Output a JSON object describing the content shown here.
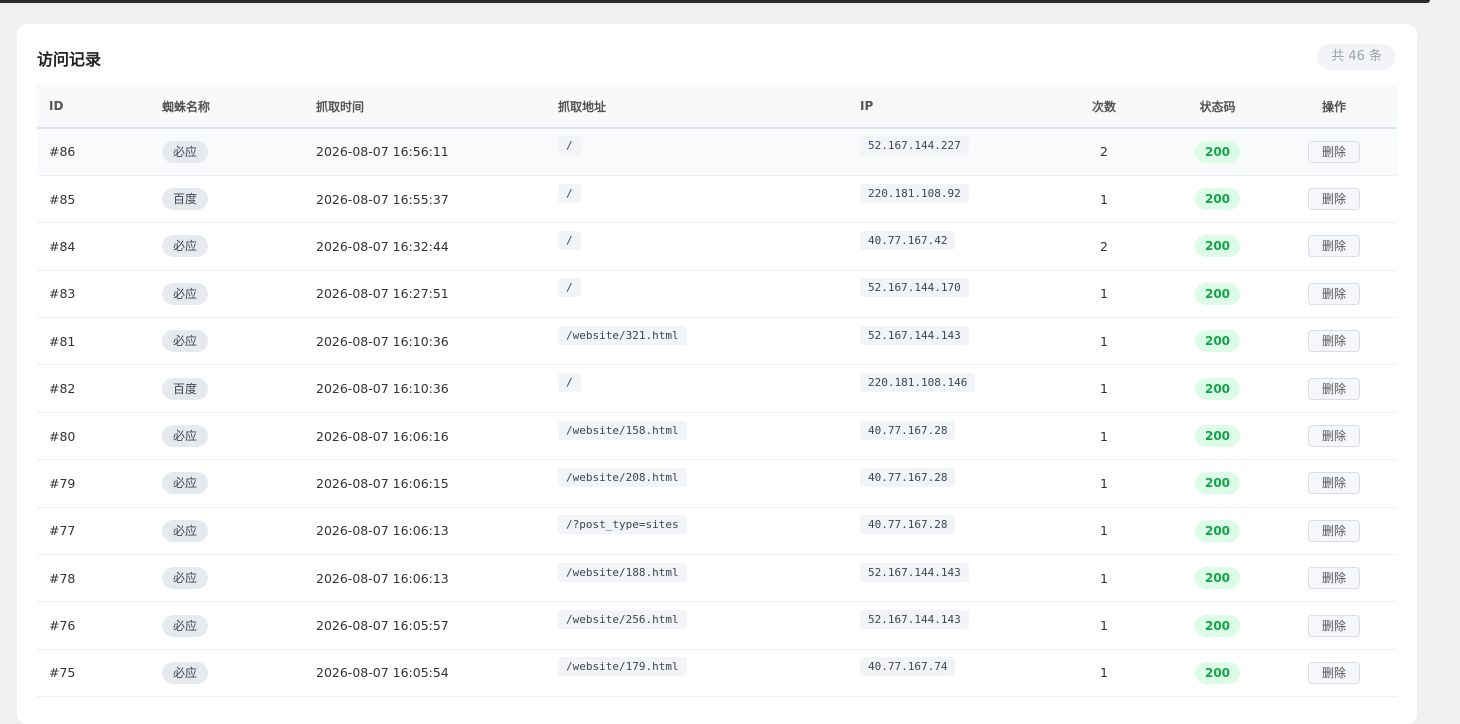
{
  "card": {
    "title": "访问记录",
    "total": "共 46 条"
  },
  "columns": [
    "ID",
    "蜘蛛名称",
    "抓取时间",
    "抓取地址",
    "IP",
    "次数",
    "状态码",
    "操作"
  ],
  "rows": [
    {
      "id": "#86",
      "spider": "必应",
      "time": "2026-08-07 16:56:11",
      "url": "/",
      "ip": "52.167.144.227",
      "count": "2",
      "status": "200",
      "action": "删除"
    },
    {
      "id": "#85",
      "spider": "百度",
      "time": "2026-08-07 16:55:37",
      "url": "/",
      "ip": "220.181.108.92",
      "count": "1",
      "status": "200",
      "action": "删除"
    },
    {
      "id": "#84",
      "spider": "必应",
      "time": "2026-08-07 16:32:44",
      "url": "/",
      "ip": "40.77.167.42",
      "count": "2",
      "status": "200",
      "action": "删除"
    },
    {
      "id": "#83",
      "spider": "必应",
      "time": "2026-08-07 16:27:51",
      "url": "/",
      "ip": "52.167.144.170",
      "count": "1",
      "status": "200",
      "action": "删除"
    },
    {
      "id": "#81",
      "spider": "必应",
      "time": "2026-08-07 16:10:36",
      "url": "/website/321.html",
      "ip": "52.167.144.143",
      "count": "1",
      "status": "200",
      "action": "删除"
    },
    {
      "id": "#82",
      "spider": "百度",
      "time": "2026-08-07 16:10:36",
      "url": "/",
      "ip": "220.181.108.146",
      "count": "1",
      "status": "200",
      "action": "删除"
    },
    {
      "id": "#80",
      "spider": "必应",
      "time": "2026-08-07 16:06:16",
      "url": "/website/158.html",
      "ip": "40.77.167.28",
      "count": "1",
      "status": "200",
      "action": "删除"
    },
    {
      "id": "#79",
      "spider": "必应",
      "time": "2026-08-07 16:06:15",
      "url": "/website/208.html",
      "ip": "40.77.167.28",
      "count": "1",
      "status": "200",
      "action": "删除"
    },
    {
      "id": "#77",
      "spider": "必应",
      "time": "2026-08-07 16:06:13",
      "url": "/?post_type=sites",
      "ip": "40.77.167.28",
      "count": "1",
      "status": "200",
      "action": "删除"
    },
    {
      "id": "#78",
      "spider": "必应",
      "time": "2026-08-07 16:06:13",
      "url": "/website/188.html",
      "ip": "52.167.144.143",
      "count": "1",
      "status": "200",
      "action": "删除"
    },
    {
      "id": "#76",
      "spider": "必应",
      "time": "2026-08-07 16:05:57",
      "url": "/website/256.html",
      "ip": "52.167.144.143",
      "count": "1",
      "status": "200",
      "action": "删除"
    },
    {
      "id": "#75",
      "spider": "必应",
      "time": "2026-08-07 16:05:54",
      "url": "/website/179.html",
      "ip": "40.77.167.74",
      "count": "1",
      "status": "200",
      "action": "删除"
    }
  ],
  "colors": {
    "status_bg": "#dcfce7",
    "status_text": "#16a34a",
    "badge_bg": "#e6eaef"
  }
}
